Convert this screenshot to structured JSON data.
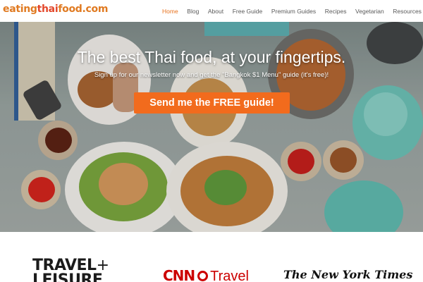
{
  "brand": {
    "logo_part1": "eating",
    "logo_part2": "thai",
    "logo_part3": "food",
    "logo_part4": ".com"
  },
  "nav": {
    "items": [
      {
        "label": "Home",
        "active": true
      },
      {
        "label": "Blog"
      },
      {
        "label": "About"
      },
      {
        "label": "Free Guide"
      },
      {
        "label": "Premium Guides"
      },
      {
        "label": "Recipes"
      },
      {
        "label": "Vegetarian"
      },
      {
        "label": "Resources"
      }
    ]
  },
  "hero": {
    "title": "The best Thai food, at your fingertips.",
    "subtitle": "Sign up for our newsletter now and get the \"Bangkok $1 Menu\" guide (it's free)!",
    "cta_label": "Send me the FREE guide!"
  },
  "press": {
    "travel_leisure_line1": "TRAVEL",
    "travel_leisure_plus": "+",
    "travel_leisure_line2": "LEISURE",
    "cnn_mark": "CNN",
    "cnn_word": "Travel",
    "nyt": "The New York Times"
  },
  "colors": {
    "accent": "#f26b1d",
    "active_nav": "#e8731f",
    "logo_orange": "#e07a21",
    "logo_red": "#e3472b",
    "cnn_red": "#cc0000"
  }
}
